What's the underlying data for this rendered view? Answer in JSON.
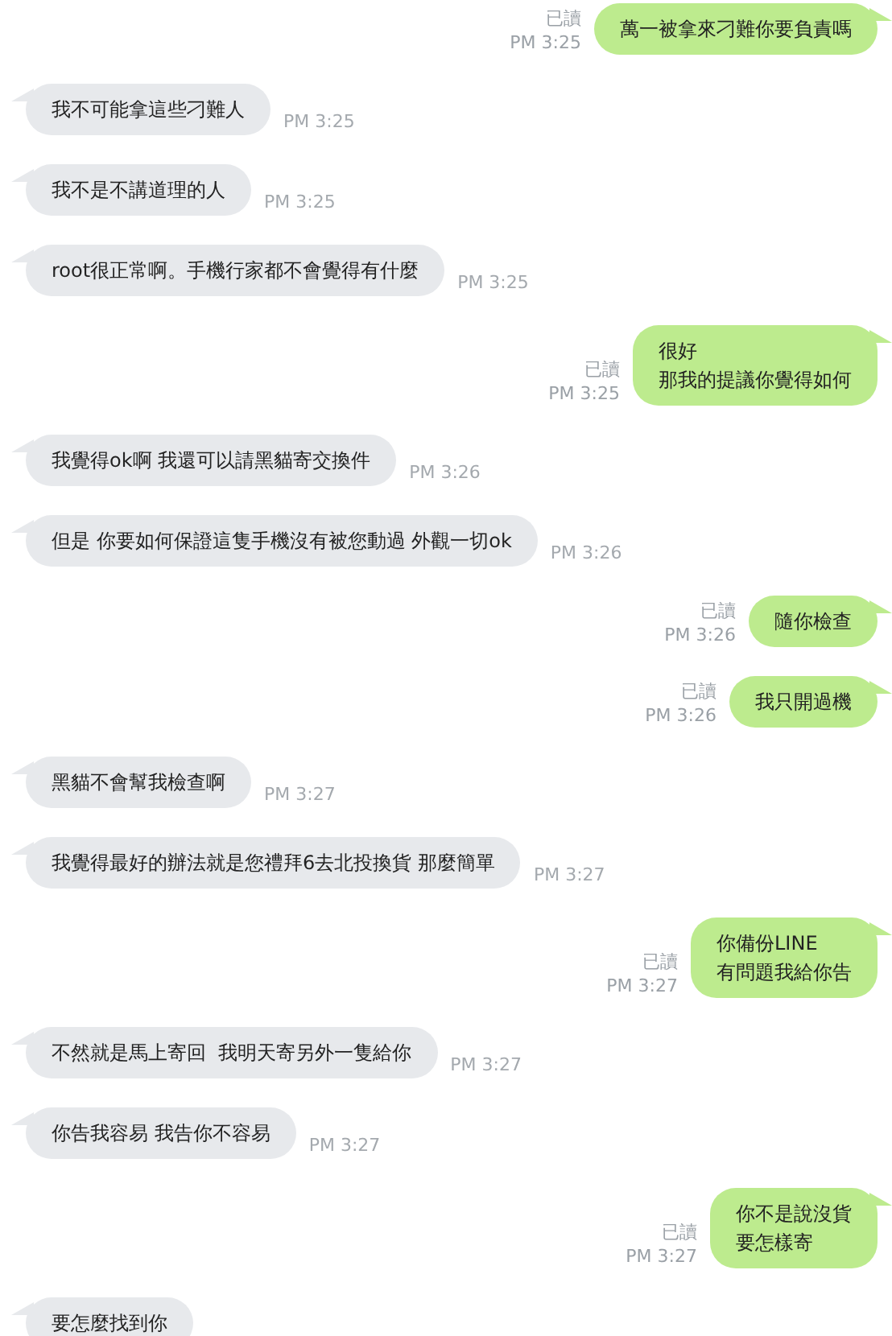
{
  "messages": [
    {
      "kind": "outgoing",
      "lines": [
        "萬一被拿來刁難你要負責嗎"
      ],
      "read": true,
      "read_label": "已讀",
      "time": "PM 3:25"
    },
    {
      "kind": "incoming",
      "lines": [
        "我不可能拿這些刁難人"
      ],
      "time": "PM 3:25"
    },
    {
      "kind": "incoming",
      "lines": [
        "我不是不講道理的人"
      ],
      "time": "PM 3:25"
    },
    {
      "kind": "incoming",
      "lines": [
        "root很正常啊。手機行家都不會覺得有什麼"
      ],
      "time": "PM 3:25"
    },
    {
      "kind": "outgoing",
      "lines": [
        "很好",
        "那我的提議你覺得如何"
      ],
      "read": true,
      "read_label": "已讀",
      "time": "PM 3:25"
    },
    {
      "kind": "incoming",
      "lines": [
        "我覺得ok啊 我還可以請黑貓寄交換件"
      ],
      "time": "PM 3:26"
    },
    {
      "kind": "incoming",
      "lines": [
        "但是 你要如何保證這隻手機沒有被您動過 外觀一切ok"
      ],
      "time": "PM 3:26"
    },
    {
      "kind": "outgoing",
      "lines": [
        "隨你檢查"
      ],
      "read": true,
      "read_label": "已讀",
      "time": "PM 3:26"
    },
    {
      "kind": "outgoing",
      "lines": [
        "我只開過機"
      ],
      "read": true,
      "read_label": "已讀",
      "time": "PM 3:26"
    },
    {
      "kind": "incoming",
      "lines": [
        "黑貓不會幫我檢查啊"
      ],
      "time": "PM 3:27"
    },
    {
      "kind": "incoming",
      "lines": [
        "我覺得最好的辦法就是您禮拜6去北投換貨 那麼簡單"
      ],
      "time": "PM 3:27"
    },
    {
      "kind": "outgoing",
      "lines": [
        "你備份LINE",
        "有問題我給你告"
      ],
      "read": true,
      "read_label": "已讀",
      "time": "PM 3:27"
    },
    {
      "kind": "incoming",
      "lines": [
        "不然就是馬上寄回  我明天寄另外一隻給你"
      ],
      "time": "PM 3:27"
    },
    {
      "kind": "incoming",
      "lines": [
        "你告我容易 我告你不容易"
      ],
      "time": "PM 3:27"
    },
    {
      "kind": "outgoing",
      "lines": [
        "你不是說沒貨",
        "要怎樣寄"
      ],
      "read": true,
      "read_label": "已讀",
      "time": "PM 3:27"
    },
    {
      "kind": "incoming",
      "lines": [
        "要怎麼找到你"
      ]
    }
  ]
}
